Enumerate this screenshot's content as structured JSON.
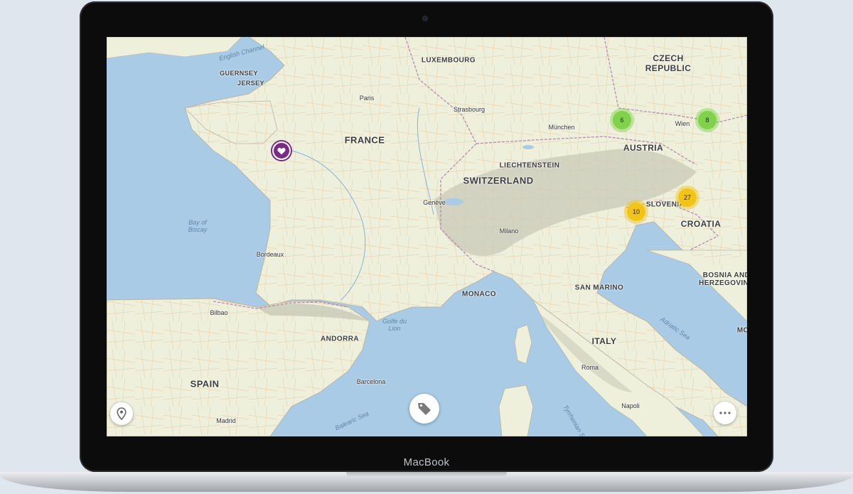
{
  "device": {
    "brand_label": "MacBook"
  },
  "map": {
    "countries": [
      {
        "id": "czech-republic",
        "name": "CZECH\nREPUBLIC"
      },
      {
        "id": "luxembourg",
        "name": "LUXEMBOURG"
      },
      {
        "id": "france",
        "name": "FRANCE"
      },
      {
        "id": "switzerland",
        "name": "SWITZERLAND"
      },
      {
        "id": "liechtenstein",
        "name": "LIECHTENSTEIN"
      },
      {
        "id": "austria",
        "name": "AUSTRIA"
      },
      {
        "id": "slovenia",
        "name": "SLOVENIA"
      },
      {
        "id": "croatia",
        "name": "CROATIA"
      },
      {
        "id": "bosnia",
        "name": "BOSNIA AND\nHERZEGOVINA"
      },
      {
        "id": "monaco",
        "name": "MONACO"
      },
      {
        "id": "san-marino",
        "name": "SAN MARINO"
      },
      {
        "id": "italy",
        "name": "ITALY"
      },
      {
        "id": "andorra",
        "name": "ANDORRA"
      },
      {
        "id": "spain",
        "name": "SPAIN"
      },
      {
        "id": "guernsey",
        "name": "GUERNSEY"
      },
      {
        "id": "jersey",
        "name": "JERSEY"
      },
      {
        "id": "montenegro-partial",
        "name": "MC"
      }
    ],
    "cities": [
      "Paris",
      "Strasbourg",
      "München",
      "Wien",
      "Genève",
      "Milano",
      "Bordeaux",
      "Bilbao",
      "Barcelona",
      "Madrid",
      "Roma",
      "Napoli"
    ],
    "seas": [
      "English Channel",
      "Bay of\nBiscay",
      "Golfe du\nLion",
      "Balearic Sea",
      "Adriatic Sea",
      "Tyrrhenian Sea"
    ],
    "clusters": [
      {
        "count": "6",
        "color": "green"
      },
      {
        "count": "8",
        "color": "green"
      },
      {
        "count": "27",
        "color": "yellow"
      },
      {
        "count": "10",
        "color": "yellow"
      }
    ],
    "favorite_marker": {
      "icon": "heart-icon",
      "color": "#7b2b82"
    }
  },
  "controls": {
    "locate_icon": "location-pin-icon",
    "tag_icon": "tag-icon",
    "more_icon": "more-dots-icon"
  },
  "colors": {
    "sea": "#a9cbe6",
    "land": "#eef0dc",
    "mountains": "#c9c9b8",
    "cluster_green": "#7fd24a",
    "cluster_yellow": "#f2c418",
    "favorite": "#7b2b82"
  }
}
